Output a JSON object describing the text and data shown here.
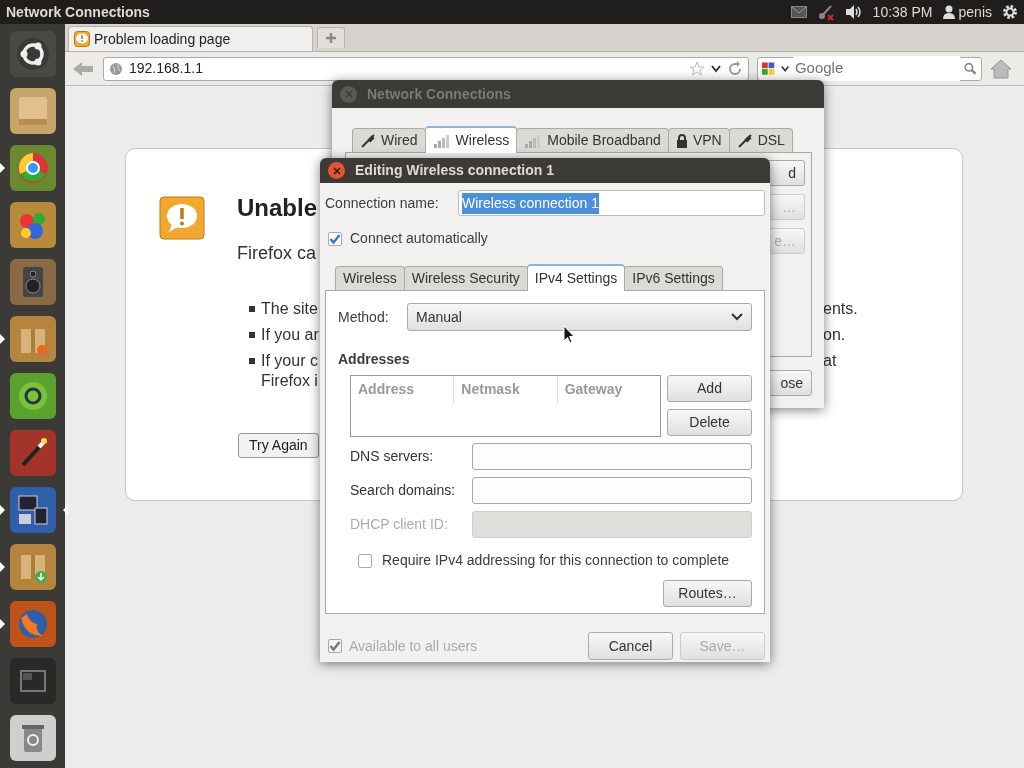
{
  "top_panel": {
    "title": "Network Connections",
    "time": "10:38 PM",
    "user": "penis"
  },
  "launcher": {
    "items": [
      {
        "kind": "logo",
        "running": false,
        "focused": false
      },
      {
        "kind": "folder",
        "running": false,
        "focused": false
      },
      {
        "kind": "browser",
        "running": true,
        "focused": false
      },
      {
        "kind": "paint",
        "running": false,
        "focused": false
      },
      {
        "kind": "speaker",
        "running": false,
        "focused": false
      },
      {
        "kind": "package",
        "running": true,
        "focused": false
      },
      {
        "kind": "ring",
        "running": false,
        "focused": false
      },
      {
        "kind": "wand",
        "running": false,
        "focused": false
      },
      {
        "kind": "monitor",
        "running": true,
        "focused": true
      },
      {
        "kind": "download",
        "running": true,
        "focused": false
      },
      {
        "kind": "globe",
        "running": true,
        "focused": false
      },
      {
        "kind": "workspace",
        "running": false,
        "focused": false
      },
      {
        "kind": "trash",
        "running": false,
        "focused": false
      }
    ]
  },
  "browser": {
    "tab": {
      "title": "Problem loading page"
    },
    "url": "192.168.1.1",
    "search": {
      "placeholder": "Google"
    },
    "error_page": {
      "title": "Unable",
      "message": "Firefox ca",
      "bullets": [
        {
          "lines": [
            "The site"
          ],
          "right": "ents."
        },
        {
          "lines": [
            "If you ar"
          ],
          "right": "on."
        },
        {
          "lines": [
            "If your c",
            "Firefox i"
          ],
          "right": "at"
        }
      ],
      "button": "Try Again"
    }
  },
  "network_window": {
    "title": "Network Connections",
    "active": false,
    "tabs": [
      {
        "label": "Wired",
        "kind": "plug",
        "selected": false
      },
      {
        "label": "Wireless",
        "kind": "bars",
        "selected": true
      },
      {
        "label": "Mobile Broadband",
        "kind": "bars",
        "selected": false
      },
      {
        "label": "VPN",
        "kind": "lock",
        "selected": false
      },
      {
        "label": "DSL",
        "kind": "plug",
        "selected": false
      }
    ],
    "side_buttons": [
      {
        "label": "d",
        "disabled": false
      },
      {
        "label": "…",
        "disabled": true
      },
      {
        "label": "e…",
        "disabled": true
      }
    ],
    "close_button": "ose"
  },
  "edit_dialog": {
    "title": "Editing Wireless connection 1",
    "active": true,
    "connection_name": {
      "label": "Connection name:",
      "value": "Wireless connection 1"
    },
    "connect_automatically": {
      "label": "Connect automatically",
      "checked": true
    },
    "tabs": [
      {
        "label": "Wireless",
        "selected": false
      },
      {
        "label": "Wireless Security",
        "selected": false
      },
      {
        "label": "IPv4 Settings",
        "selected": true
      },
      {
        "label": "IPv6 Settings",
        "selected": false
      }
    ],
    "method": {
      "label": "Method:",
      "value": "Manual"
    },
    "addresses": {
      "heading": "Addresses",
      "columns": [
        "Address",
        "Netmask",
        "Gateway"
      ],
      "buttons": [
        "Add",
        "Delete"
      ]
    },
    "fields": [
      {
        "label": "DNS servers:",
        "disabled": false
      },
      {
        "label": "Search domains:",
        "disabled": false
      },
      {
        "label": "DHCP client ID:",
        "disabled": true
      }
    ],
    "require_ipv4": {
      "label": "Require IPv4 addressing for this connection to complete",
      "checked": false
    },
    "routes_button": "Routes…",
    "available_to_all": {
      "label": "Available to all users",
      "checked": true,
      "disabled": true
    },
    "buttons": [
      {
        "label": "Cancel",
        "disabled": false
      },
      {
        "label": "Save…",
        "disabled": true
      }
    ]
  }
}
